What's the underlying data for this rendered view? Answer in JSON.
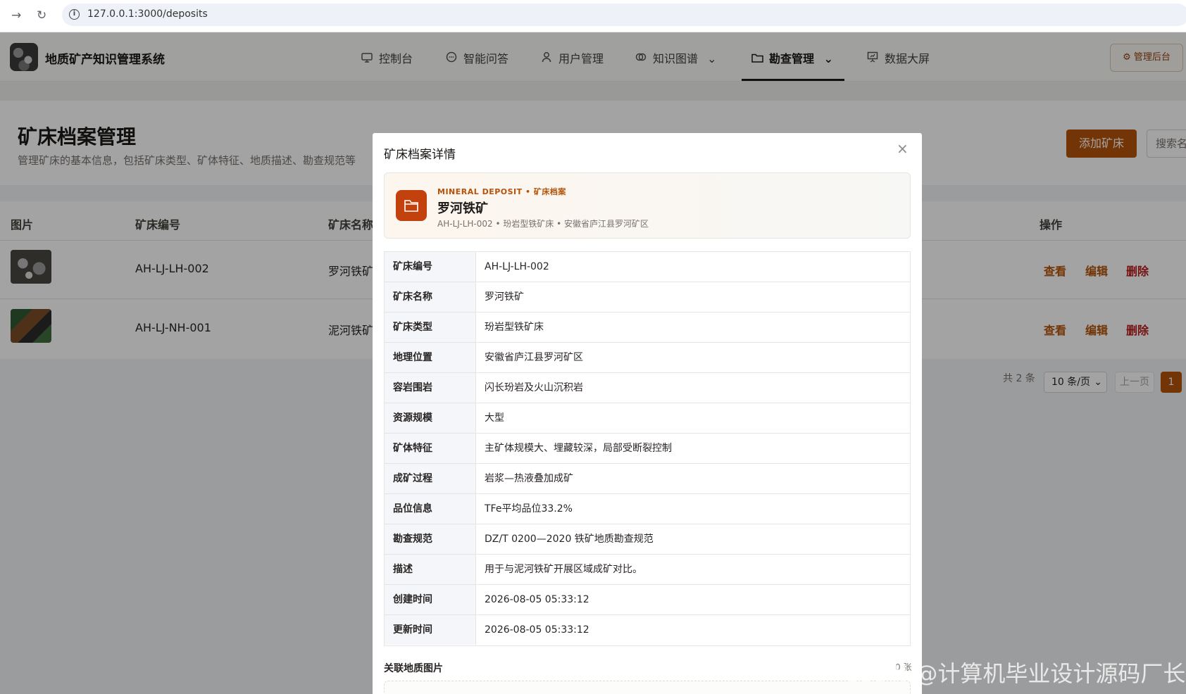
{
  "browser": {
    "url": "127.0.0.1:3000/deposits"
  },
  "header": {
    "app_title": "地质矿产知识管理系统",
    "nav": [
      {
        "label": "控制台",
        "icon": "monitor-icon"
      },
      {
        "label": "智能问答",
        "icon": "chat-icon"
      },
      {
        "label": "用户管理",
        "icon": "user-icon"
      },
      {
        "label": "知识图谱",
        "icon": "graph-icon"
      },
      {
        "label": "勘查管理",
        "icon": "folder-icon"
      },
      {
        "label": "数据大屏",
        "icon": "presentation-icon"
      }
    ],
    "active_nav": "勘查管理",
    "admin_button": "管理后台"
  },
  "page": {
    "title": "矿床档案管理",
    "subtitle": "管理矿床的基本信息，包括矿床类型、矿体特征、地质描述、勘查规范等",
    "add_button": "添加矿床",
    "search_placeholder": "搜索名称"
  },
  "table": {
    "columns": [
      "图片",
      "矿床编号",
      "矿床名称",
      "操作"
    ],
    "rows": [
      {
        "code": "AH-LJ-LH-002",
        "name": "罗河铁矿"
      },
      {
        "code": "AH-LJ-NH-001",
        "name": "泥河铁矿"
      }
    ],
    "actions": {
      "view": "查看",
      "edit": "编辑",
      "delete": "删除"
    }
  },
  "pagination": {
    "total": "共 2 条",
    "page_size": "10 条/页",
    "prev": "上一页",
    "current_page": "1"
  },
  "modal": {
    "title": "矿床档案详情",
    "tag": "MINERAL DEPOSIT • 矿床档案",
    "name": "罗河铁矿",
    "meta": "AH-LJ-LH-002 • 玢岩型铁矿床 • 安徽省庐江县罗河矿区",
    "fields": [
      {
        "label": "矿床编号",
        "value": "AH-LJ-LH-002"
      },
      {
        "label": "矿床名称",
        "value": "罗河铁矿"
      },
      {
        "label": "矿床类型",
        "value": "玢岩型铁矿床"
      },
      {
        "label": "地理位置",
        "value": "安徽省庐江县罗河矿区"
      },
      {
        "label": "容岩围岩",
        "value": "闪长玢岩及火山沉积岩"
      },
      {
        "label": "资源规模",
        "value": "大型"
      },
      {
        "label": "矿体特征",
        "value": "主矿体规模大、埋藏较深，局部受断裂控制"
      },
      {
        "label": "成矿过程",
        "value": "岩浆—热液叠加成矿"
      },
      {
        "label": "品位信息",
        "value": "TFe平均品位33.2%"
      },
      {
        "label": "勘查规范",
        "value": "DZ/T 0200—2020 铁矿地质勘查规范"
      },
      {
        "label": "描述",
        "value": "用于与泥河铁矿开展区域成矿对比。"
      },
      {
        "label": "创建时间",
        "value": "2026-08-05 05:33:12"
      },
      {
        "label": "更新时间",
        "value": "2026-08-05 05:33:12"
      }
    ],
    "images_label": "关联地质图片",
    "images_count": "0 张"
  },
  "watermark": "CSDN @计算机毕业设计源码厂长",
  "colors": {
    "accent": "#b45309",
    "danger": "#b91c1c",
    "hero_icon": "#c2410c"
  }
}
